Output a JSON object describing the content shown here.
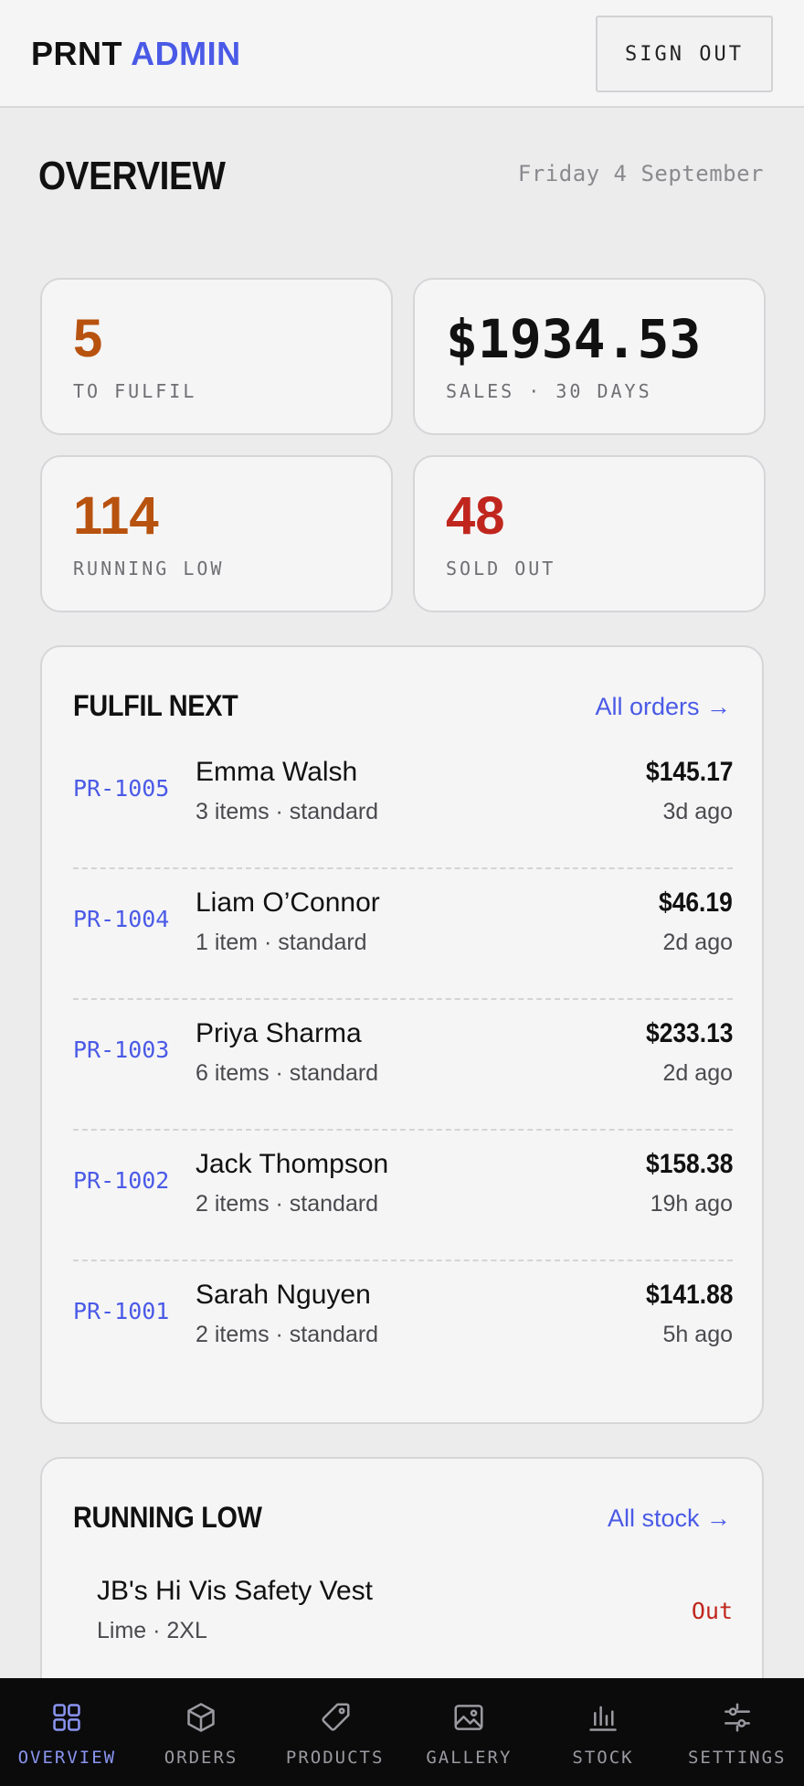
{
  "header": {
    "brand_part1": "PRNT",
    "brand_part2": "ADMIN",
    "sign_out_label": "SIGN OUT"
  },
  "overview": {
    "title": "OVERVIEW",
    "date": "Friday 4 September"
  },
  "stats": [
    {
      "value": "5",
      "label": "TO FULFIL",
      "color": "#b8520f"
    },
    {
      "value": "$1934.53",
      "label": "SALES · 30 DAYS",
      "color": "#111111"
    },
    {
      "value": "114",
      "label": "RUNNING LOW",
      "color": "#b8520f"
    },
    {
      "value": "48",
      "label": "SOLD OUT",
      "color": "#c0261d"
    }
  ],
  "fulfil_next": {
    "title": "FULFIL NEXT",
    "link_label": "All orders →",
    "orders": [
      {
        "id": "PR-1005",
        "name": "Emma Walsh",
        "meta": "3 items · standard",
        "amount": "$145.17",
        "ago": "3d ago"
      },
      {
        "id": "PR-1004",
        "name": "Liam O’Connor",
        "meta": "1 item · standard",
        "amount": "$46.19",
        "ago": "2d ago"
      },
      {
        "id": "PR-1003",
        "name": "Priya Sharma",
        "meta": "6 items · standard",
        "amount": "$233.13",
        "ago": "2d ago"
      },
      {
        "id": "PR-1002",
        "name": "Jack Thompson",
        "meta": "2 items · standard",
        "amount": "$158.38",
        "ago": "19h ago"
      },
      {
        "id": "PR-1001",
        "name": "Sarah Nguyen",
        "meta": "2 items · standard",
        "amount": "$141.88",
        "ago": "5h ago"
      }
    ]
  },
  "running_low": {
    "title": "RUNNING LOW",
    "link_label": "All stock →",
    "items": [
      {
        "name": "JB's Hi Vis Safety Vest",
        "meta": "Lime · 2XL",
        "status": "Out"
      }
    ]
  },
  "nav": {
    "items": [
      {
        "label": "OVERVIEW",
        "icon": "grid-icon",
        "active": true
      },
      {
        "label": "ORDERS",
        "icon": "box-icon",
        "active": false
      },
      {
        "label": "PRODUCTS",
        "icon": "tag-icon",
        "active": false
      },
      {
        "label": "GALLERY",
        "icon": "image-icon",
        "active": false
      },
      {
        "label": "STOCK",
        "icon": "bar-chart-icon",
        "active": false
      },
      {
        "label": "SETTINGS",
        "icon": "sliders-icon",
        "active": false
      }
    ]
  },
  "colors": {
    "accent": "#4a5ae6",
    "warning": "#b8520f",
    "danger": "#c0261d"
  }
}
